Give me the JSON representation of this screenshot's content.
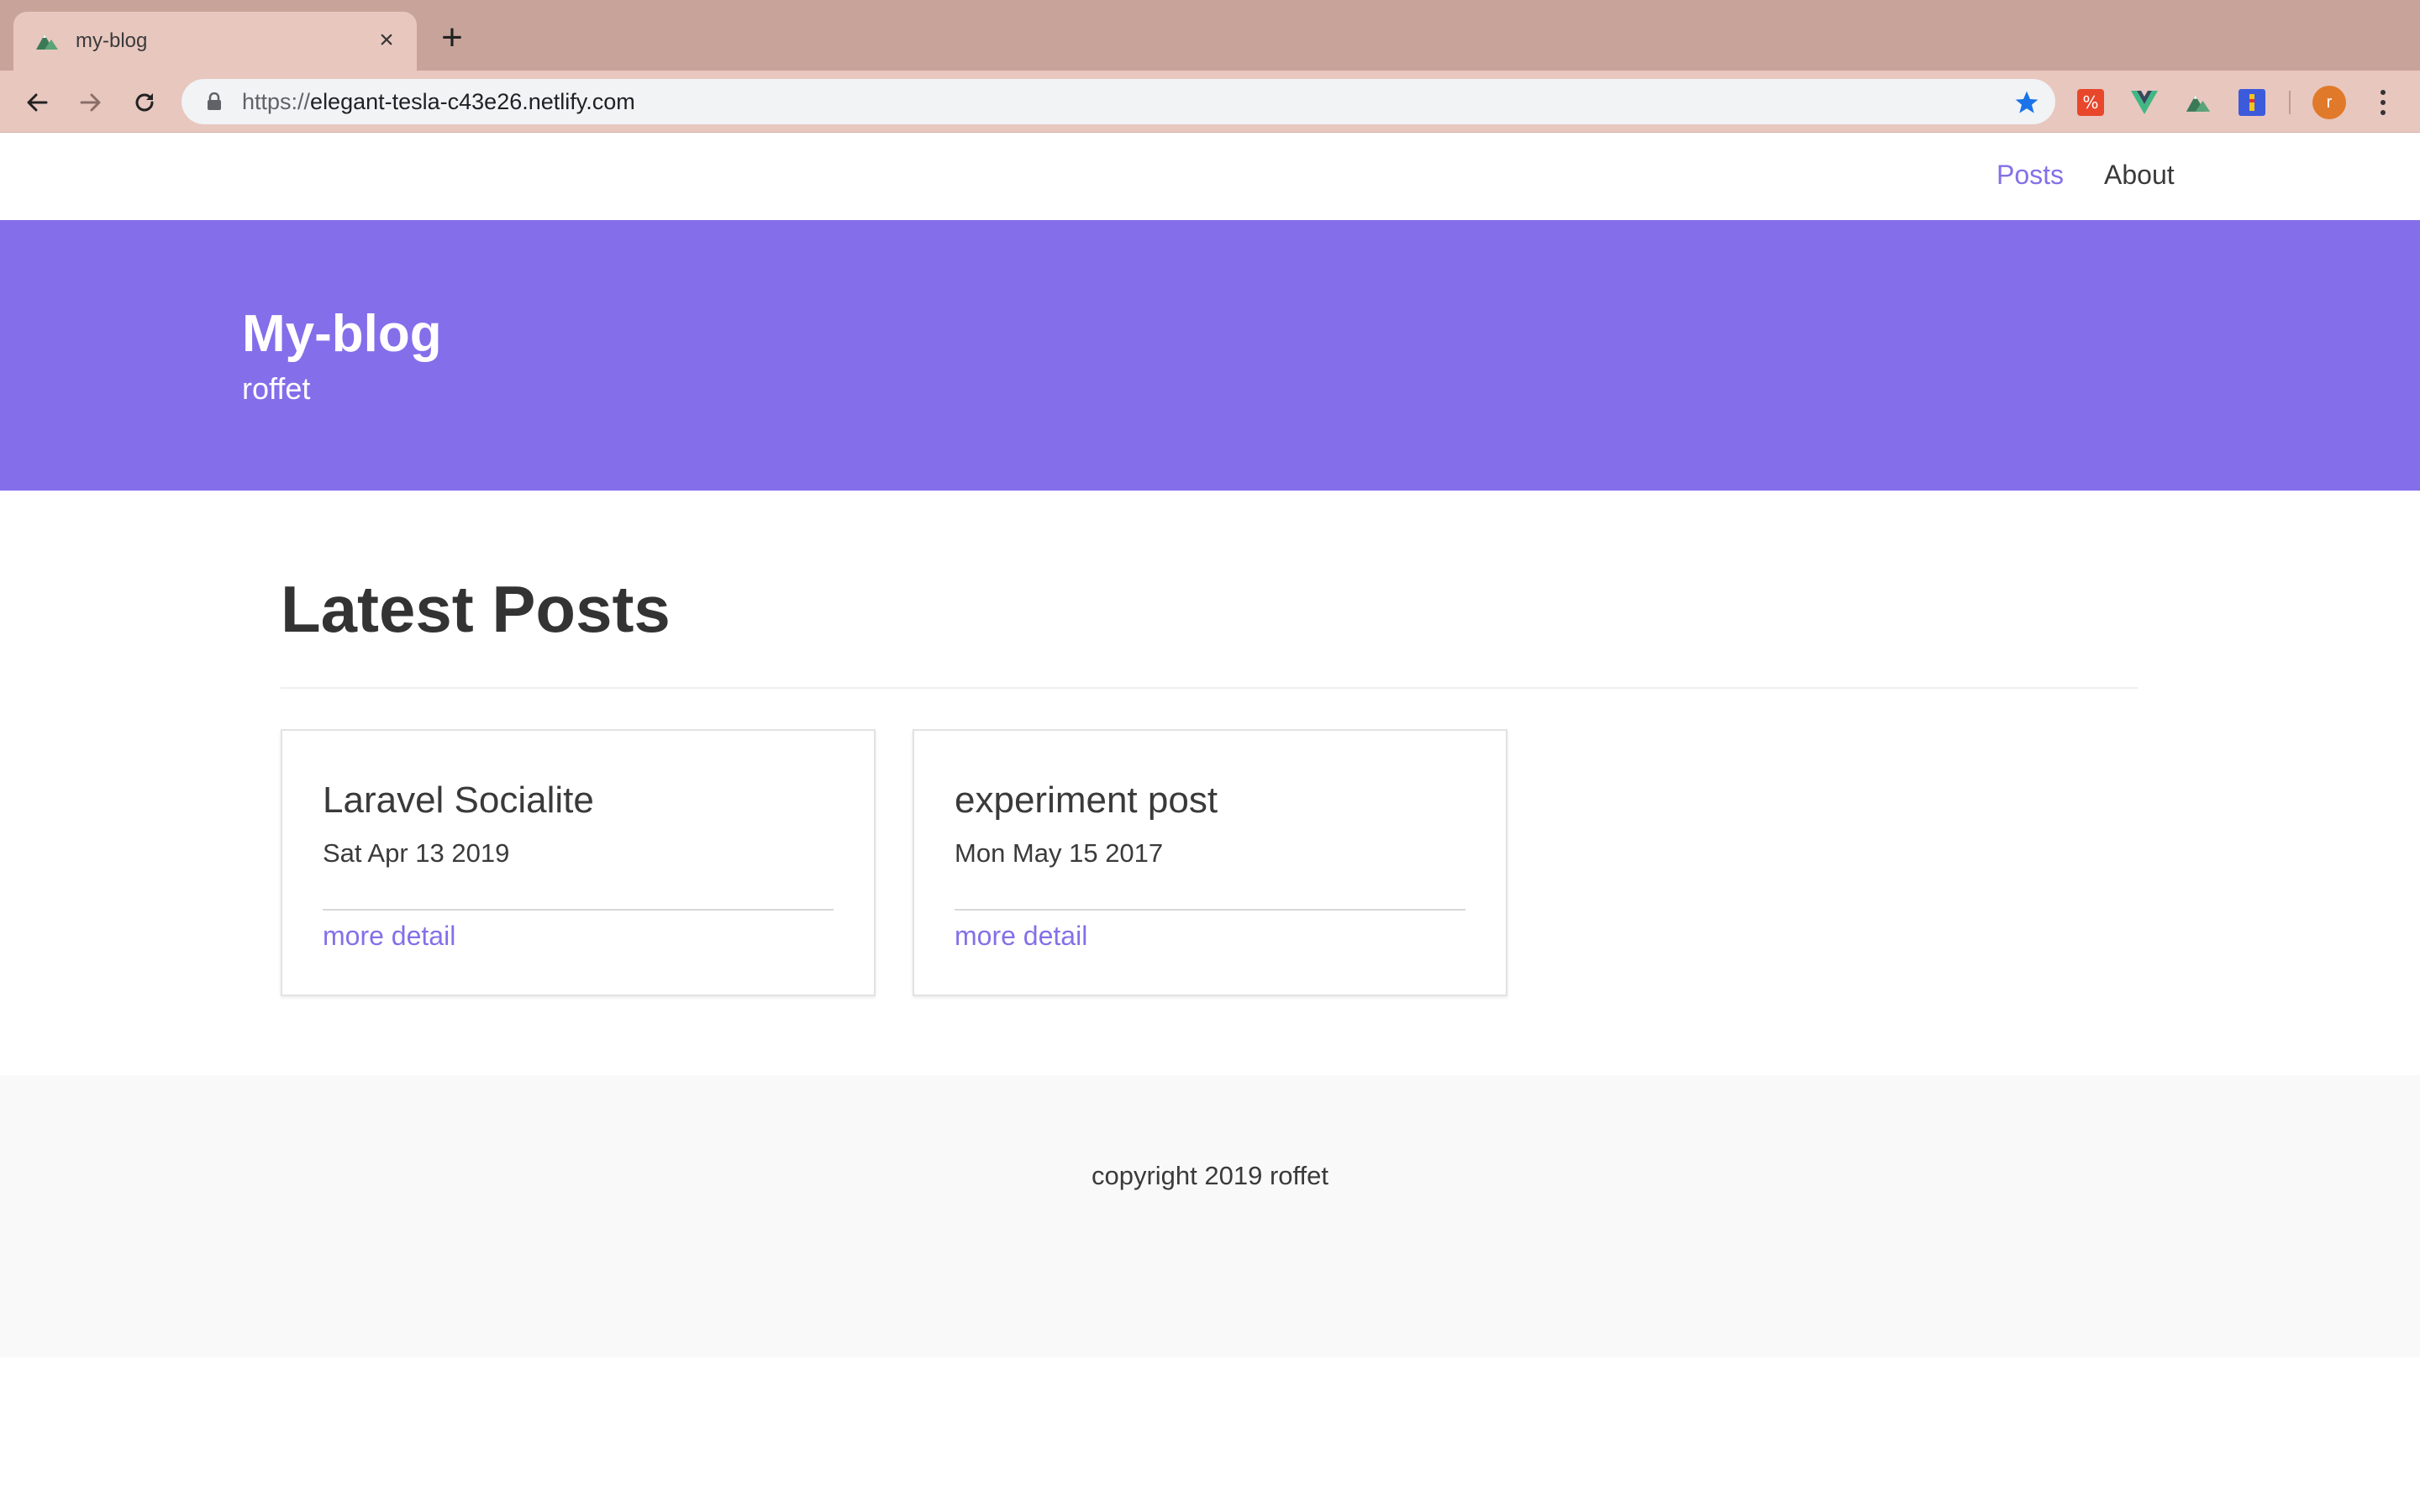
{
  "browser": {
    "tab": {
      "title": "my-blog",
      "favicon": "mountain-icon"
    },
    "url": {
      "scheme": "https://",
      "host": "elegant-tesla-c43e26.netlify.com"
    },
    "bookmark_starred": true,
    "extensions": [
      "percent-icon",
      "vue-icon",
      "mountain-icon",
      "lighthouse-icon"
    ],
    "profile_initial": "r",
    "accent_color": "#1a73e8"
  },
  "site": {
    "nav": {
      "posts_label": "Posts",
      "about_label": "About",
      "active": "Posts"
    },
    "hero": {
      "title": "My-blog",
      "subtitle": "roffet",
      "color": "#846eea"
    },
    "section_title": "Latest Posts",
    "posts": [
      {
        "title": "Laravel Socialite",
        "date": "Sat Apr 13 2019",
        "link_label": "more detail"
      },
      {
        "title": "experiment post",
        "date": "Mon May 15 2017",
        "link_label": "more detail"
      }
    ],
    "footer": {
      "text": "copyright 2019 roffet"
    },
    "link_color": "#8470e8"
  }
}
